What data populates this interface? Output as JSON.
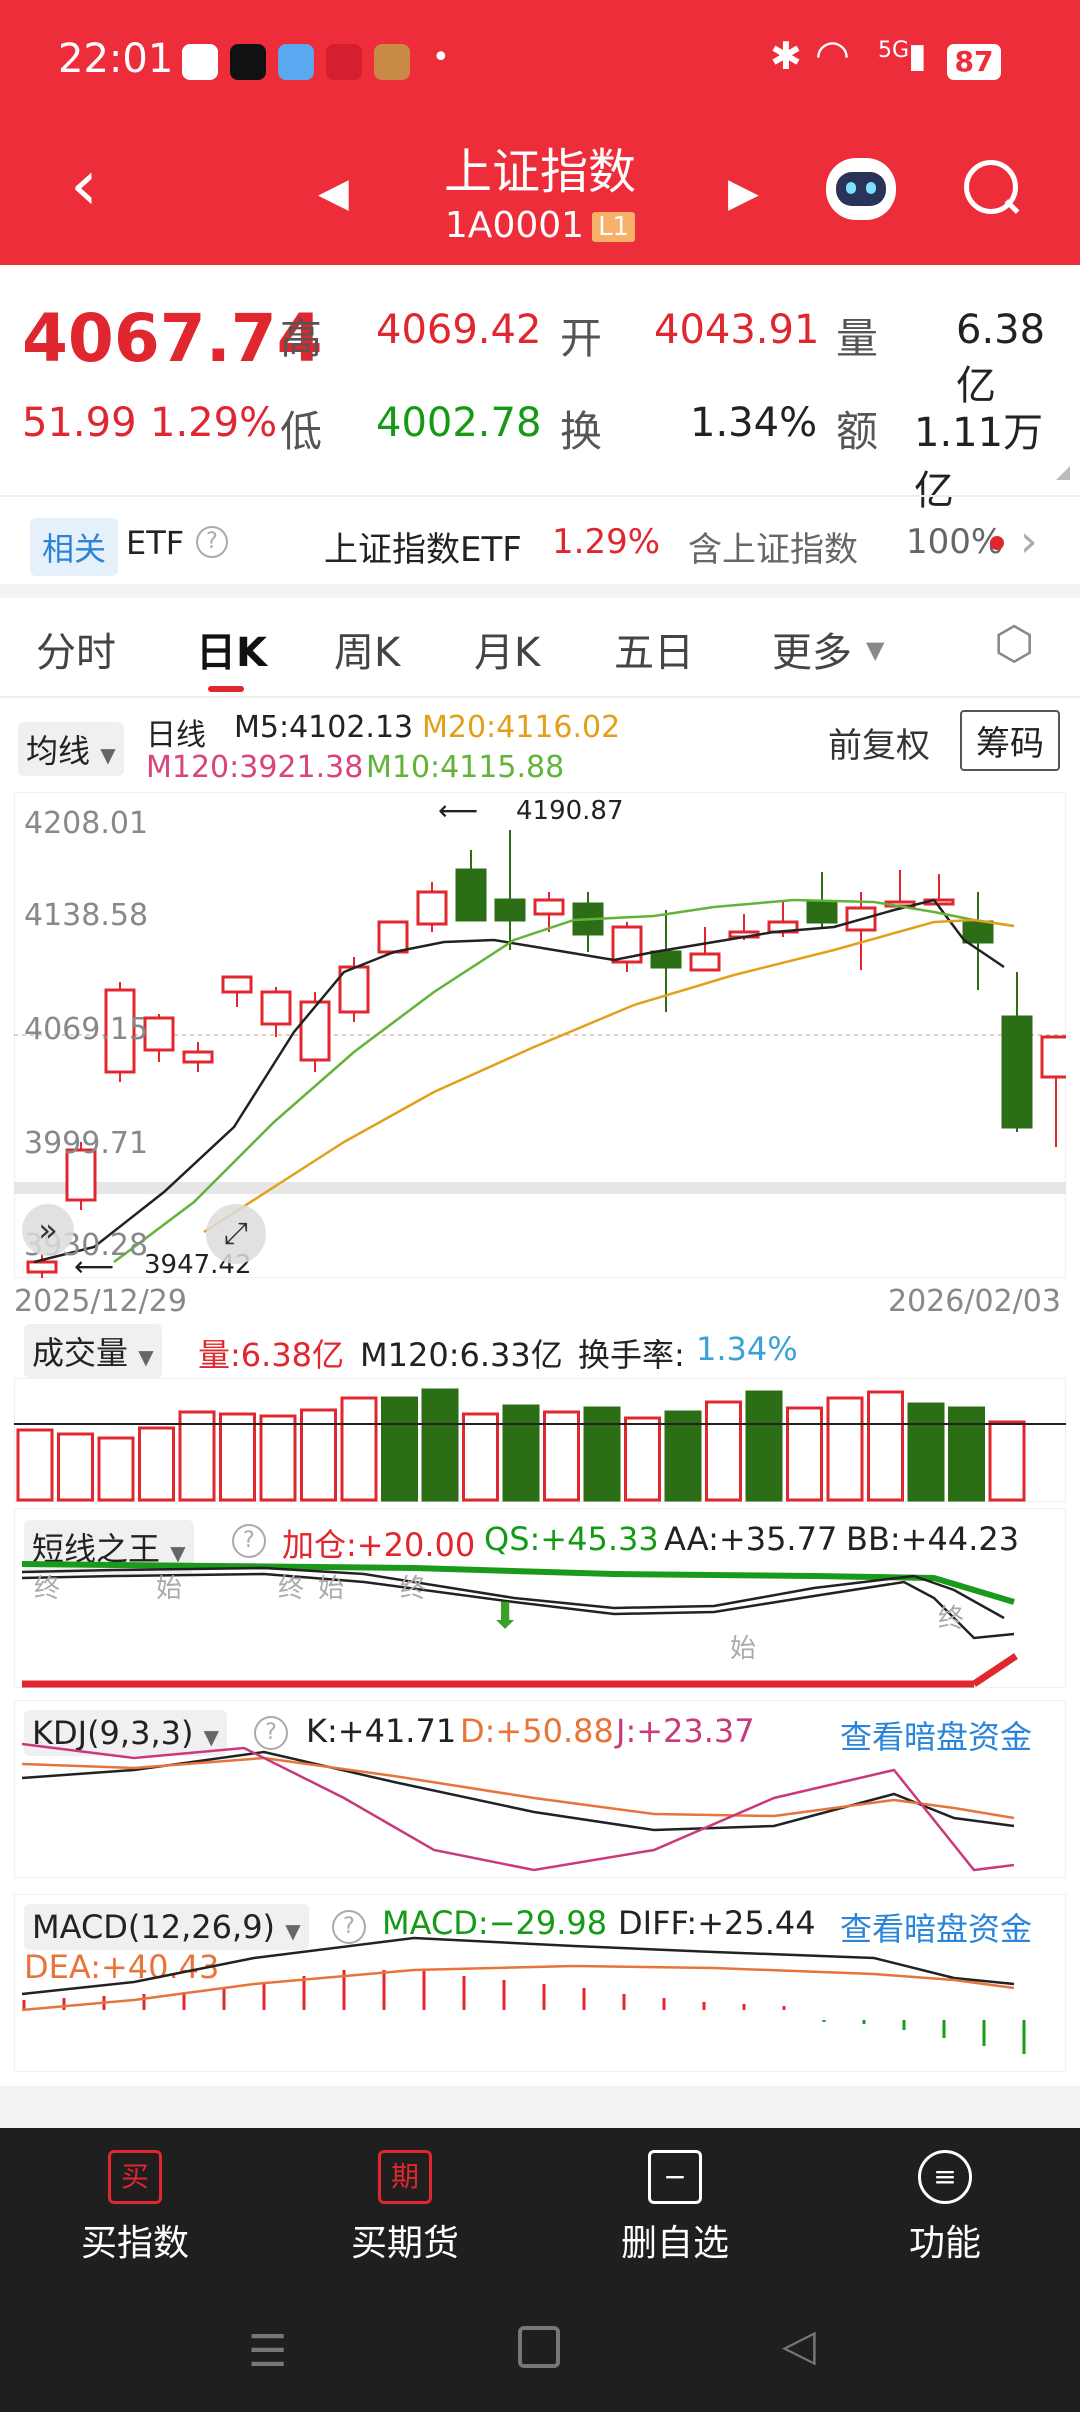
{
  "status": {
    "time": "22:01",
    "battery": "87",
    "network": "5G"
  },
  "header": {
    "title": "上证指数",
    "code": "1A0001",
    "level": "L1"
  },
  "quote": {
    "price": "4067.74",
    "change": "51.99",
    "pct": "1.29%",
    "high_label": "高",
    "high": "4069.42",
    "open_label": "开",
    "open": "4043.91",
    "vol_label": "量",
    "vol": "6.38亿",
    "low_label": "低",
    "low": "4002.78",
    "turn_label": "换",
    "turn": "1.34%",
    "amt_label": "额",
    "amt": "1.11万亿"
  },
  "related": {
    "tag": "相关",
    "etf": "ETF",
    "name": "上证指数ETF",
    "pct": "1.29%",
    "contains": "含上证指数",
    "ratio": "100%"
  },
  "tabs": [
    "分时",
    "日K",
    "周K",
    "月K",
    "五日",
    "更多"
  ],
  "kline": {
    "ma_toggle": "均线",
    "period": "日线",
    "m5": "M5:4102.13",
    "m20": "M20:4116.02",
    "m120": "M120:3921.38",
    "m10": "M10:4115.88",
    "adjust": "前复权",
    "chips": "筹码",
    "y_labels": [
      "4208.01",
      "4138.58",
      "4069.15",
      "3999.71",
      "3930.28"
    ],
    "max_marker": "4190.87",
    "min_marker": "3947.42",
    "date_start": "2025/12/29",
    "date_end": "2026/02/03"
  },
  "volume": {
    "label": "成交量",
    "vol": "量:6.38亿",
    "m120": "M120:6.33亿",
    "turn_label": "换手率:",
    "turn": "1.34%"
  },
  "dx": {
    "label": "短线之王",
    "jiacang": "加仓:+20.00",
    "qs": "QS:+45.33",
    "aa": "AA:+35.77",
    "bb": "BB:+44.23",
    "marks": [
      "终",
      "始",
      "终",
      "始",
      "终",
      "始",
      "终"
    ]
  },
  "kdj": {
    "label": "KDJ(9,3,3)",
    "k": "K:+41.71",
    "d": "D:+50.88",
    "j": "J:+23.37",
    "link": "查看暗盘资金"
  },
  "macd": {
    "label": "MACD(12,26,9)",
    "macd": "MACD:−29.98",
    "diff": "DIFF:+25.44",
    "dea": "DEA:+40.43",
    "link": "查看暗盘资金"
  },
  "bottom": [
    {
      "label": "买指数",
      "icon": "买"
    },
    {
      "label": "买期货",
      "icon": "期"
    },
    {
      "label": "删自选",
      "icon": "−"
    },
    {
      "label": "功能",
      "icon": "≡"
    }
  ],
  "colors": {
    "header": "#ee2d3a",
    "up": "#e0262e",
    "down": "#2c6e16",
    "ma5": "#222222",
    "ma10": "#62b33a",
    "ma20": "#e2a01a"
  }
}
